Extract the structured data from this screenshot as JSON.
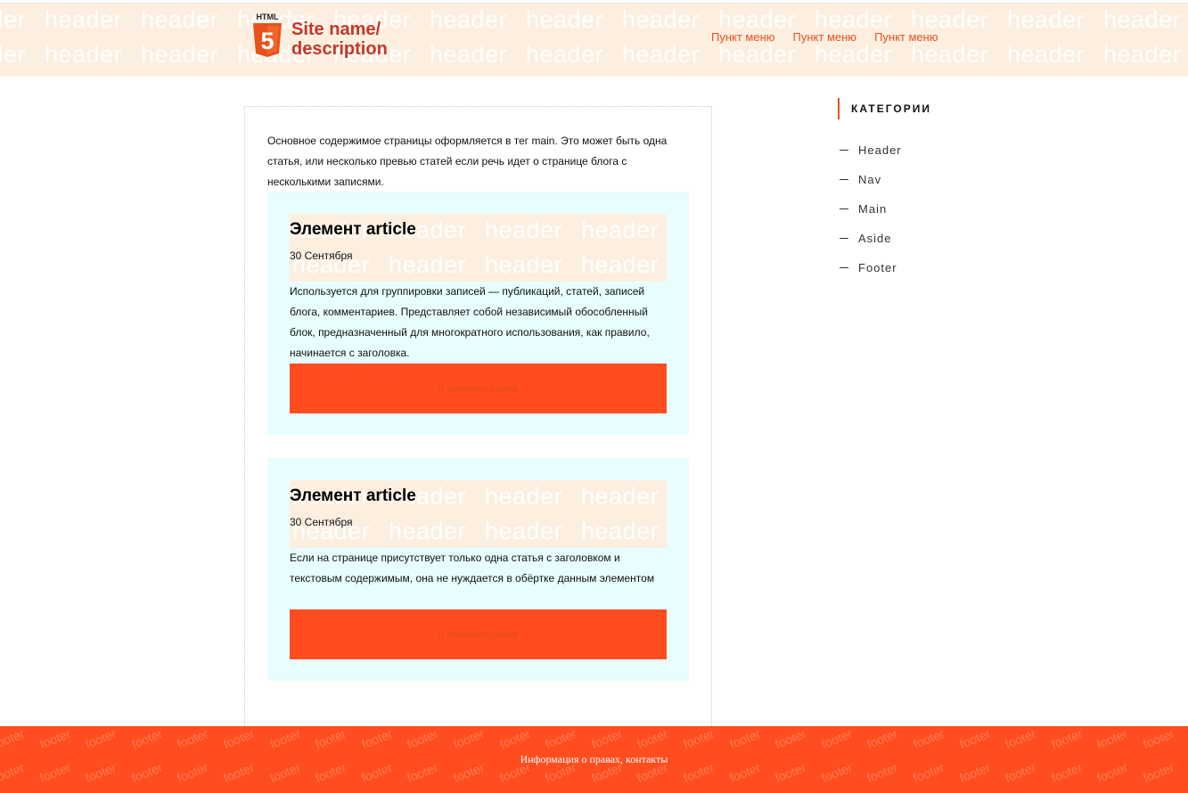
{
  "header": {
    "watermark": "header",
    "logo": {
      "icon": "html5-icon",
      "text": "HTML",
      "digit": "5",
      "color": "#e8501e"
    },
    "site_name_line1": "Site name/",
    "site_name_line2": "description",
    "nav": [
      "Пункт меню",
      "Пункт меню",
      "Пункт меню"
    ]
  },
  "main": {
    "intro": "Основное содержимое страницы оформляется в тег main. Это может быть одна статья, или несколько превью статей если речь идет о странице блога с несколькими записями.",
    "articles": [
      {
        "title": "Элемент article",
        "date": "30 Сентября",
        "body": "Используется для группировки записей — публикаций, статей, записей блога, комментариев. Представляет собой независимый обособленный блок, предназначенный для многократного использования, как правило, начинается с заголовка.",
        "comments": "0 комментариев"
      },
      {
        "title": "Элемент article",
        "date": "30 Сентября",
        "body": "Если на странице присутствует только одна статья с заголовком и текстовым содержимым, она не нуждается в обёртке данным элементом",
        "comments": "0 комментариев"
      }
    ]
  },
  "aside": {
    "title": "КАТЕГОРИИ",
    "items": [
      "Header",
      "Nav",
      "Main",
      "Aside",
      "Footer"
    ]
  },
  "footer": {
    "watermark": "footer",
    "text": "Информация о правах, контакты"
  },
  "colors": {
    "accent": "#e8501e",
    "footer_bg": "#ff4d1f",
    "header_bg": "#fdefe0",
    "article_bg": "#e8fdfd"
  }
}
